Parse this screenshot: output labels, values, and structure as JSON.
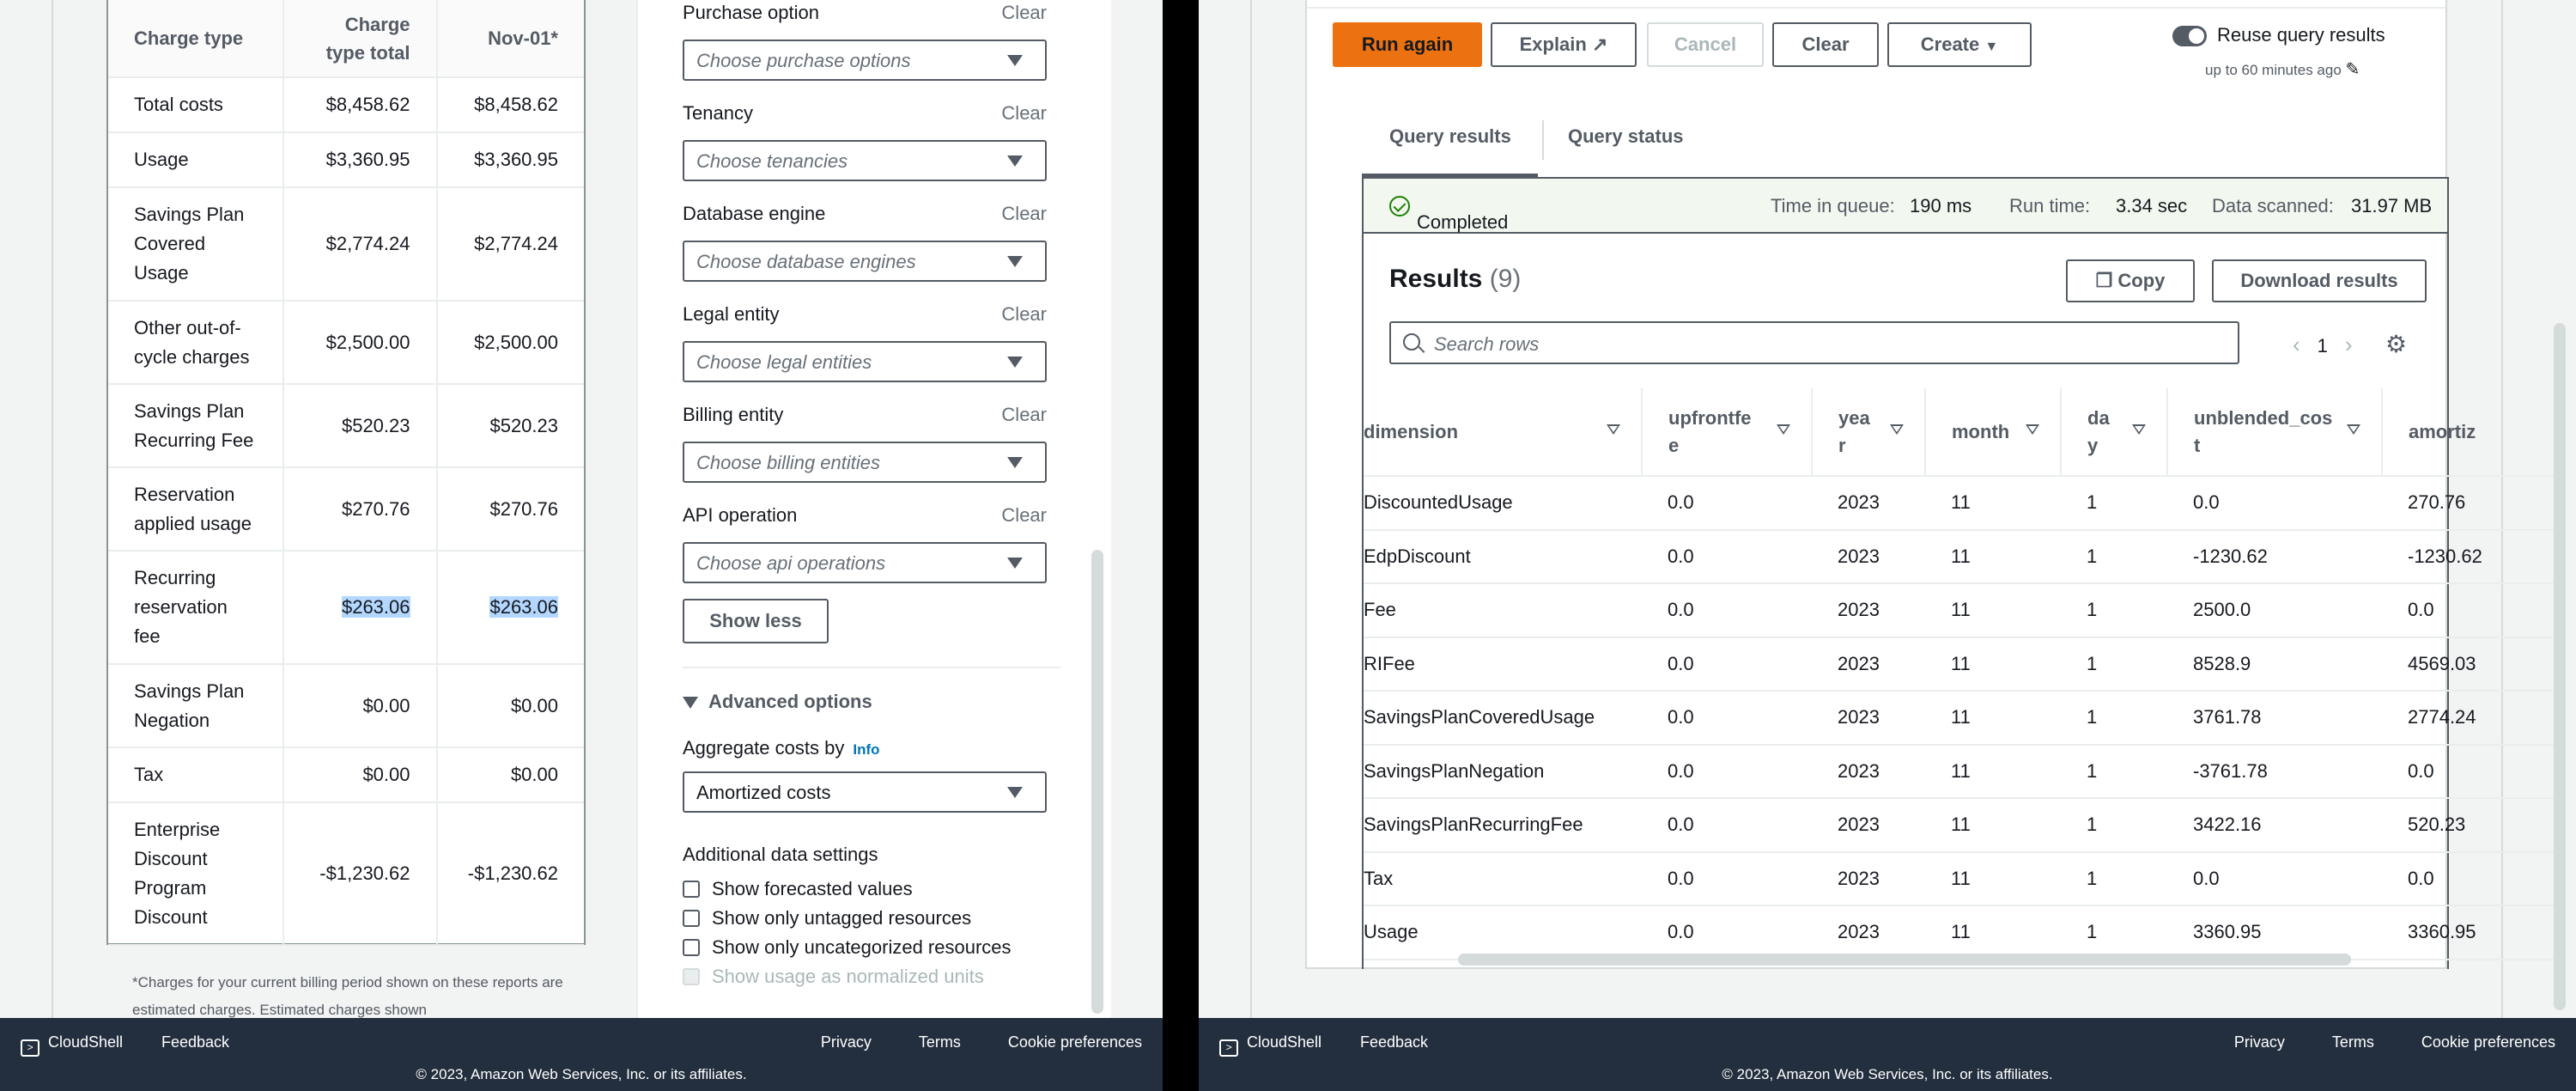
{
  "left": {
    "cost_table": {
      "headers": [
        "Charge type",
        "Charge type total",
        "Nov-01*"
      ],
      "rows": [
        {
          "type": "Total costs",
          "total": "$8,458.62",
          "nov": "$8,458.62"
        },
        {
          "type": "Usage",
          "total": "$3,360.95",
          "nov": "$3,360.95"
        },
        {
          "type": "Savings Plan Covered Usage",
          "total": "$2,774.24",
          "nov": "$2,774.24"
        },
        {
          "type": "Other out-of-cycle charges",
          "total": "$2,500.00",
          "nov": "$2,500.00"
        },
        {
          "type": "Savings Plan Recurring Fee",
          "total": "$520.23",
          "nov": "$520.23"
        },
        {
          "type": "Reservation applied usage",
          "total": "$270.76",
          "nov": "$270.76"
        },
        {
          "type": "Recurring reservation fee",
          "total": "$263.06",
          "nov": "$263.06"
        },
        {
          "type": "Savings Plan Negation",
          "total": "$0.00",
          "nov": "$0.00"
        },
        {
          "type": "Tax",
          "total": "$0.00",
          "nov": "$0.00"
        },
        {
          "type": "Enterprise Discount Program Discount",
          "total": "-$1,230.62",
          "nov": "-$1,230.62"
        }
      ],
      "footnote": "*Charges for your current billing period shown on these reports are estimated charges. Estimated charges shown"
    },
    "filters": {
      "clear_label": "Clear",
      "groups": [
        {
          "label": "Purchase option",
          "placeholder": "Choose purchase options"
        },
        {
          "label": "Tenancy",
          "placeholder": "Choose tenancies"
        },
        {
          "label": "Database engine",
          "placeholder": "Choose database engines"
        },
        {
          "label": "Legal entity",
          "placeholder": "Choose legal entities"
        },
        {
          "label": "Billing entity",
          "placeholder": "Choose billing entities"
        },
        {
          "label": "API operation",
          "placeholder": "Choose api operations"
        }
      ],
      "show_less": "Show less",
      "advanced_options": "Advanced options",
      "aggregate_label": "Aggregate costs by",
      "info": "Info",
      "aggregate_value": "Amortized costs",
      "additional_settings": "Additional data settings",
      "checkboxes": [
        {
          "label": "Show forecasted values",
          "disabled": false
        },
        {
          "label": "Show only untagged resources",
          "disabled": false
        },
        {
          "label": "Show only uncategorized resources",
          "disabled": false
        },
        {
          "label": "Show usage as normalized units",
          "disabled": true
        }
      ]
    }
  },
  "right": {
    "buttons": {
      "run_again": "Run again",
      "explain": "Explain",
      "cancel": "Cancel",
      "clear": "Clear",
      "create": "Create"
    },
    "reuse_label": "Reuse query results",
    "reuse_sub": "up to 60 minutes ago",
    "tabs": [
      "Query results",
      "Query status"
    ],
    "status": {
      "completed": "Completed",
      "queue_label": "Time in queue:",
      "queue_value": "190 ms",
      "run_label": "Run time:",
      "run_value": "3.34 sec",
      "scanned_label": "Data scanned:",
      "scanned_value": "31.97 MB"
    },
    "results": {
      "title": "Results",
      "count": "(9)",
      "copy": "Copy",
      "download": "Download results",
      "search_placeholder": "Search rows",
      "page": "1",
      "columns": [
        "dimension",
        "upfrontfe e",
        "yea r",
        "month",
        "da y",
        "unblended_cos t",
        "amortiz"
      ],
      "rows": [
        [
          "DiscountedUsage",
          "0.0",
          "2023",
          "11",
          "1",
          "0.0",
          "270.76"
        ],
        [
          "EdpDiscount",
          "0.0",
          "2023",
          "11",
          "1",
          "-1230.62",
          "-1230.62"
        ],
        [
          "Fee",
          "0.0",
          "2023",
          "11",
          "1",
          "2500.0",
          "0.0"
        ],
        [
          "RIFee",
          "0.0",
          "2023",
          "11",
          "1",
          "8528.9",
          "4569.03"
        ],
        [
          "SavingsPlanCoveredUsage",
          "0.0",
          "2023",
          "11",
          "1",
          "3761.78",
          "2774.24"
        ],
        [
          "SavingsPlanNegation",
          "0.0",
          "2023",
          "11",
          "1",
          "-3761.78",
          "0.0"
        ],
        [
          "SavingsPlanRecurringFee",
          "0.0",
          "2023",
          "11",
          "1",
          "3422.16",
          "520.23"
        ],
        [
          "Tax",
          "0.0",
          "2023",
          "11",
          "1",
          "0.0",
          "0.0"
        ],
        [
          "Usage",
          "0.0",
          "2023",
          "11",
          "1",
          "3360.95",
          "3360.95"
        ]
      ]
    }
  },
  "footer": {
    "cloudshell": "CloudShell",
    "feedback": "Feedback",
    "privacy": "Privacy",
    "terms": "Terms",
    "cookies": "Cookie preferences",
    "copyright": "© 2023, Amazon Web Services, Inc. or its affiliates."
  }
}
